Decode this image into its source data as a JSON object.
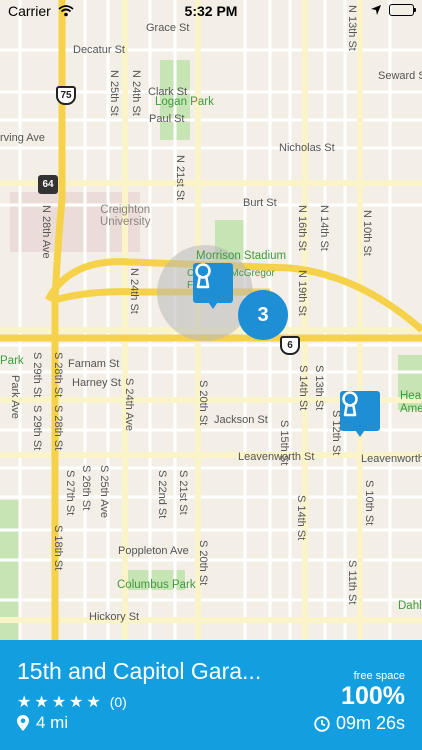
{
  "status_bar": {
    "carrier": "Carrier",
    "time": "5:32 PM"
  },
  "map": {
    "streets": {
      "grace_st": "Grace St",
      "decatur_st": "Decatur St",
      "clark_st": "Clark St",
      "paul_st": "Paul St",
      "burt_st": "Burt St",
      "nicholas_st": "Nicholas St",
      "seward_st": "Seward St",
      "irving_ave": "rving Ave",
      "farnam_st": "Farnam St",
      "harney_st": "Harney St",
      "jackson_st": "Jackson St",
      "leavenworth_st": "Leavenworth St",
      "leavenworth_st_2": "Leavenworth St",
      "poppleton_ave": "Poppleton Ave",
      "hickory_st": "Hickory St",
      "n_28th_ave": "N 28th Ave",
      "n25": "N 25th St",
      "n24": "N 24th St",
      "n21": "N 21st St",
      "n24b": "N 24th St",
      "n19": "N 19th St",
      "n16": "N 16th St",
      "n14": "N 14th St",
      "n13": "N 13th St",
      "n10": "N 10th St",
      "s29": "S 29th St",
      "s28": "S 28th St",
      "s29b": "S 29th St",
      "s28b": "S 28th St",
      "s24a": "S 24th Ave",
      "s20": "S 20th St",
      "s20b": "S 20th St",
      "s22": "S 22nd St",
      "s21": "S 21st St",
      "s25": "S 25th Ave",
      "s26": "S 26th St",
      "s27": "S 27th St",
      "s15": "S 15th St",
      "s14": "S 14th St",
      "s14b": "S 14th St",
      "s13": "S 13th St",
      "s12": "S 12th St",
      "s10": "S 10th St",
      "s11": "S 11th St",
      "s18": "S 18th St",
      "park_ave": "Park Ave"
    },
    "places": {
      "logan_park": "Logan Park",
      "creighton": "Creighton\nUniversity",
      "morrison": "Morrison Stadium",
      "cleveland": "CreightonMcGregor\nFreeman",
      "columbus_park": "Columbus Park",
      "park_left": "Park",
      "hea": "Hea\nAme",
      "dahl": "Dahl"
    },
    "route_shields": [
      "75",
      "64",
      "6"
    ],
    "cluster_count": "3"
  },
  "parking": {
    "title": "15th and Capitol Gara...",
    "rating": 5,
    "review_count": "(0)",
    "distance": "4 mi",
    "free_space_label": "free space",
    "free_space_value": "100%",
    "timer": "09m 26s"
  },
  "colors": {
    "accent": "#139ee0",
    "pin": "#1e8fd5",
    "highway": "#f5d24a",
    "park": "#c7e5b4"
  }
}
